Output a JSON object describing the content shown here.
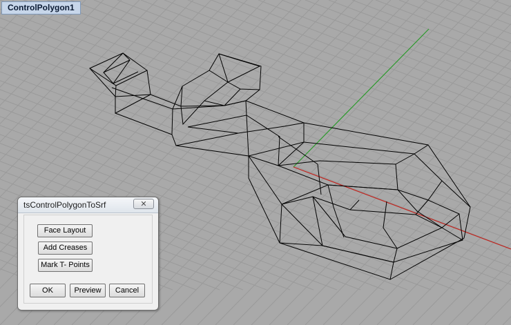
{
  "viewport": {
    "title": "ControlPolygon1",
    "background_color": "#a9a9a9",
    "grid_color": "#9a9a9a",
    "x_axis_color": "#c0201a",
    "y_axis_color": "#2a9a2a",
    "wireframe_color": "#000000"
  },
  "dialog": {
    "title": "tsControlPolygonToSrf",
    "close_glyph": "✕",
    "face_layout_label": "Face Layout",
    "add_creases_label": "Add Creases",
    "mark_tpoints_label": "Mark T- Points",
    "ok_label": "OK",
    "preview_label": "Preview",
    "cancel_label": "Cancel"
  }
}
